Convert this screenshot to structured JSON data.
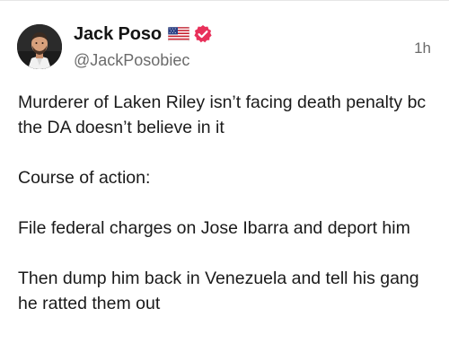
{
  "post": {
    "author": {
      "display_name": "Jack Poso",
      "handle": "@JackPosobiec",
      "flag_icon": "us-flag-icon",
      "verified_icon": "verified-badge-icon",
      "verified_color": "#e8305a"
    },
    "timestamp": "1h",
    "paragraphs": [
      "Murderer of Laken Riley isn’t facing death penalty bc the DA doesn’t believe in it",
      "Course of action:",
      "File federal charges on Jose Ibarra and deport him",
      "Then dump him back in Venezuela and tell his gang he ratted them out"
    ]
  }
}
